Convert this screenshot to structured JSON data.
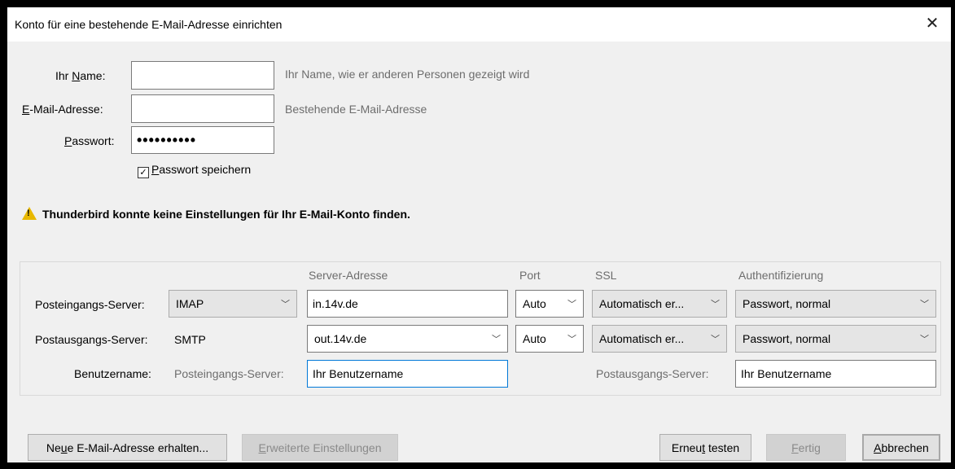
{
  "window": {
    "title": "Konto für eine bestehende E-Mail-Adresse einrichten",
    "close_label": "✕"
  },
  "form": {
    "name_label": "Ihr Name:",
    "name_value": "",
    "name_hint": "Ihr Name, wie er anderen Personen gezeigt wird",
    "email_label": "E-Mail-Adresse:",
    "email_value": "",
    "email_hint": "Bestehende E-Mail-Adresse",
    "password_label": "Passwort:",
    "password_value": "••••••••••",
    "remember_label": "Passwort speichern",
    "remember_checked": true
  },
  "warning": {
    "text": "Thunderbird konnte keine Einstellungen für Ihr E-Mail-Konto finden."
  },
  "server": {
    "headers": {
      "address": "Server-Adresse",
      "port": "Port",
      "ssl": "SSL",
      "auth": "Authentifizierung"
    },
    "incoming": {
      "label": "Posteingangs-Server:",
      "protocol": "IMAP",
      "address": "in.14v.de",
      "port": "Auto",
      "ssl": "Automatisch er...",
      "auth": "Passwort, normal"
    },
    "outgoing": {
      "label": "Postausgangs-Server:",
      "protocol": "SMTP",
      "address": "out.14v.de",
      "port": "Auto",
      "ssl": "Automatisch er...",
      "auth": "Passwort, normal"
    },
    "username": {
      "label": "Benutzername:",
      "incoming_label": "Posteingangs-Server:",
      "incoming_value": "Ihr Benutzername",
      "outgoing_label": "Postausgangs-Server:",
      "outgoing_value": "Ihr Benutzername"
    }
  },
  "buttons": {
    "new_address": "Neue E-Mail-Adresse erhalten...",
    "advanced": "Erweiterte Einstellungen",
    "retest": "Erneut testen",
    "done": "Fertig",
    "cancel": "Abbrechen"
  }
}
